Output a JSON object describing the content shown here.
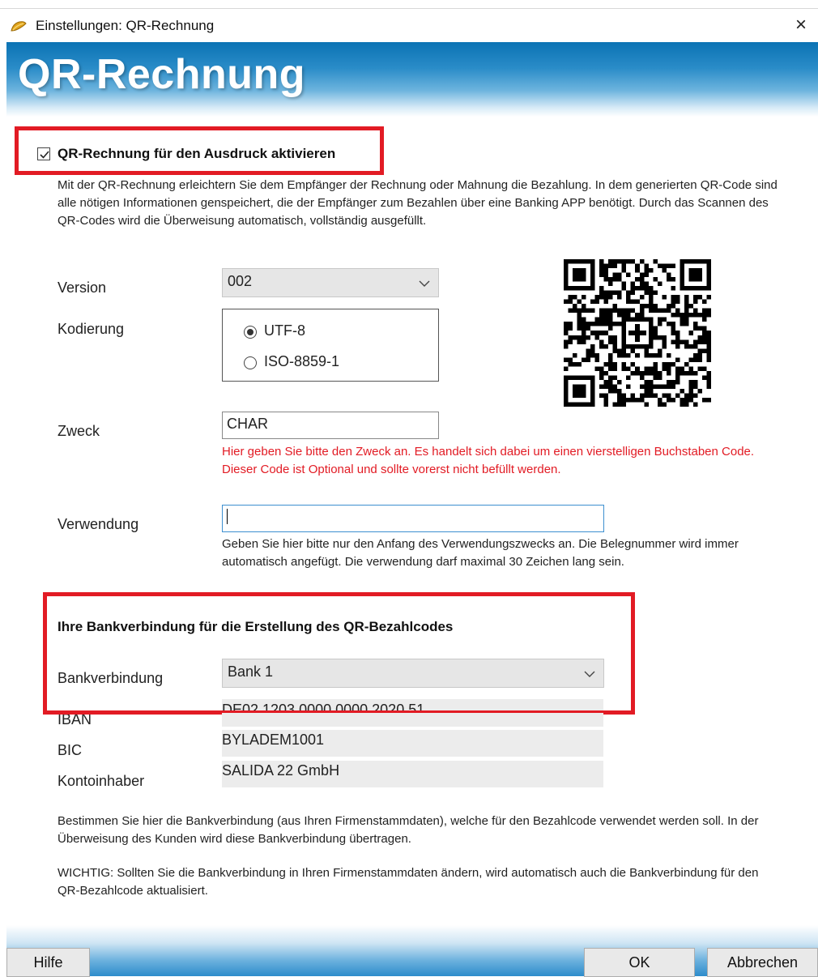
{
  "window": {
    "title": "Einstellungen: QR-Rechnung",
    "close_label": "×"
  },
  "banner": {
    "title": "QR-Rechnung"
  },
  "activate": {
    "label": "QR-Rechnung für den Ausdruck aktivieren",
    "checked": true,
    "description": "Mit der QR-Rechnung erleichtern Sie dem Empfänger der Rechnung oder Mahnung die Bezahlung. In dem generierten QR-Code sind alle nötigen Informationen genspeichert, die der Empfänger zum Bezahlen über eine Banking APP benötigt. Durch das Scannen des QR-Codes wird die Überweisung automatisch, vollständig ausgefüllt."
  },
  "version": {
    "label": "Version",
    "value": "002"
  },
  "encoding": {
    "label": "Kodierung",
    "options": [
      "UTF-8",
      "ISO-8859-1"
    ],
    "selected": "UTF-8"
  },
  "purpose": {
    "label": "Zweck",
    "value": "CHAR",
    "hint": "Hier geben Sie bitte den Zweck an. Es handelt sich dabei um einen vierstelligen Buchstaben Code. Dieser Code ist Optional und sollte vorerst nicht befüllt werden."
  },
  "usage": {
    "label": "Verwendung",
    "value": "",
    "hint": "Geben Sie hier bitte nur den Anfang des Verwendungszwecks an. Die Belegnummer wird immer automatisch angefügt. Die verwendung darf maximal 30 Zeichen lang sein."
  },
  "bank": {
    "heading": "Ihre Bankverbindung für die Erstellung des QR-Bezahlcodes",
    "connection_label": "Bankverbindung",
    "connection_value": "Bank 1",
    "iban_label": "IBAN",
    "iban_value": "DE02 1203 0000 0000 2020 51",
    "bic_label": "BIC",
    "bic_value": "BYLADEM1001",
    "holder_label": "Kontoinhaber",
    "holder_value": "SALIDA 22 GmbH"
  },
  "footer": {
    "info": "Bestimmen Sie hier die Bankverbindung (aus Ihren Firmenstammdaten), welche für den Bezahlcode verwendet werden soll. In der Überweisung des Kunden wird diese Bankverbindung übertragen.",
    "warning": "WICHTIG: Sollten Sie die Bankverbindung in Ihren Firmenstammdaten ändern, wird automatisch auch die Bankverbindung für den QR-Bezahlcode aktualisiert."
  },
  "buttons": {
    "help": "Hilfe",
    "ok": "OK",
    "cancel": "Abbrechen"
  },
  "colors": {
    "highlight_red": "#e21b24",
    "banner_blue": "#0b73b4"
  }
}
